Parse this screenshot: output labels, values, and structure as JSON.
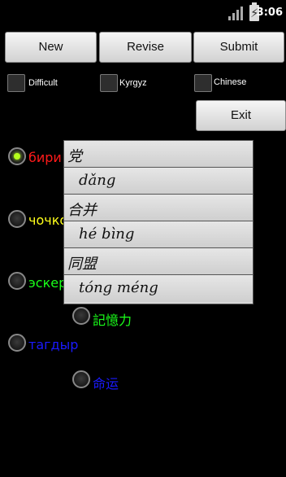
{
  "status": {
    "time": "3:06"
  },
  "toolbar": {
    "new_label": "New",
    "revise_label": "Revise",
    "submit_label": "Submit"
  },
  "options": {
    "difficult_label": "Difficult",
    "kyrgyz_label": "Kyrgyz",
    "chinese_label": "Chinese"
  },
  "exit_label": "Exit",
  "answers": [
    {
      "text": "бири",
      "color": "#ff1a1a",
      "selected": true
    },
    {
      "text": "чочко",
      "color": "#ffff1a",
      "selected": false
    },
    {
      "text": "эскер",
      "color": "#1aff1a",
      "selected": false
    },
    {
      "text": "記憶力",
      "color": "#1aff1a",
      "selected": false
    },
    {
      "text": "тагдыр",
      "color": "#1a1aff",
      "selected": false
    },
    {
      "text": "命运",
      "color": "#1a1aff",
      "selected": false
    }
  ],
  "popup": {
    "rows": [
      "党",
      "dǎng",
      "合并",
      "hé bìng",
      "同盟",
      "tóng méng"
    ]
  }
}
